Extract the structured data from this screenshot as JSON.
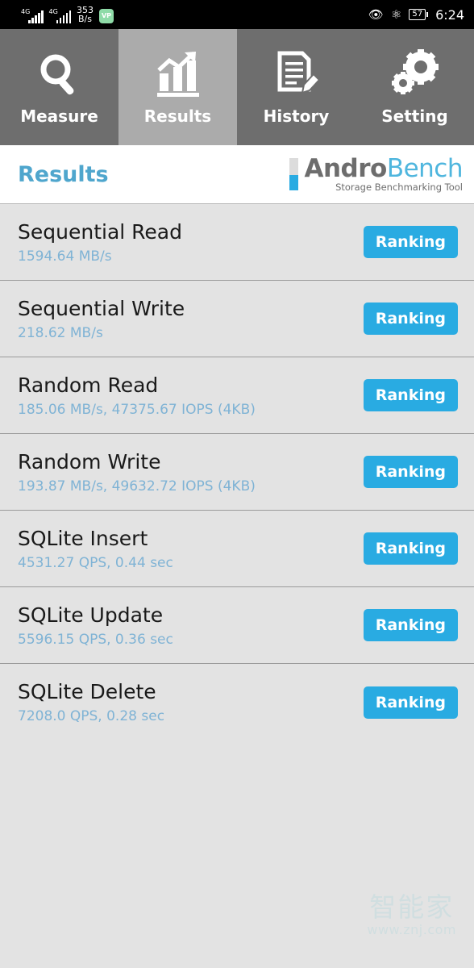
{
  "statusbar": {
    "network_speed": "353",
    "network_speed_unit": "B/s",
    "signal_1_label": "4G",
    "signal_2_label": "4G",
    "vpn_label": "VP",
    "eye_icon": "eye-icon",
    "bluetooth_icon": "bluetooth-icon",
    "battery_level": "57",
    "time": "6:24"
  },
  "tabs": [
    {
      "label": "Measure",
      "icon": "magnifier-icon",
      "active": false
    },
    {
      "label": "Results",
      "icon": "bar-chart-icon",
      "active": true
    },
    {
      "label": "History",
      "icon": "document-pencil-icon",
      "active": false
    },
    {
      "label": "Setting",
      "icon": "gears-icon",
      "active": false
    }
  ],
  "header": {
    "title": "Results",
    "logo_part1": "Andro",
    "logo_part2": "Bench",
    "logo_tagline": "Storage Benchmarking Tool"
  },
  "results": [
    {
      "title": "Sequential Read",
      "value": "1594.64 MB/s",
      "button": "Ranking"
    },
    {
      "title": "Sequential Write",
      "value": "218.62 MB/s",
      "button": "Ranking"
    },
    {
      "title": "Random Read",
      "value": "185.06 MB/s, 47375.67 IOPS (4KB)",
      "button": "Ranking"
    },
    {
      "title": "Random Write",
      "value": "193.87 MB/s, 49632.72 IOPS (4KB)",
      "button": "Ranking"
    },
    {
      "title": "SQLite Insert",
      "value": "4531.27 QPS, 0.44 sec",
      "button": "Ranking"
    },
    {
      "title": "SQLite Update",
      "value": "5596.15 QPS, 0.36 sec",
      "button": "Ranking"
    },
    {
      "title": "SQLite Delete",
      "value": "7208.0 QPS, 0.28 sec",
      "button": "Ranking"
    }
  ],
  "watermark": {
    "text": "智能家",
    "url": "www.znj.com"
  },
  "colors": {
    "accent_blue": "#29ABE2",
    "title_blue": "#4FA6CD",
    "value_blue": "#7FB3D5",
    "tab_inactive": "#6E6E6E",
    "tab_active": "#ABABAB",
    "list_bg": "#E3E3E3"
  }
}
